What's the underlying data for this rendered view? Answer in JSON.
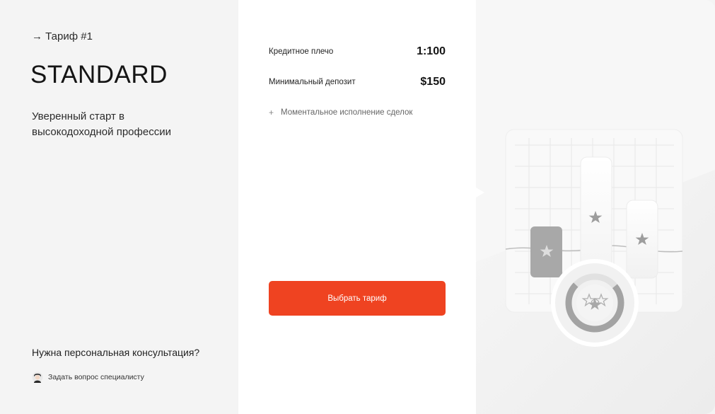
{
  "plan": {
    "tariff_number": "→ Тариф #1",
    "name": "STANDARD",
    "subtitle": "Уверенный старт в высокодоходной профессии",
    "consult_question": "Нужна персональная консультация?",
    "ask_specialist": "Задать вопрос специалисту"
  },
  "details": {
    "leverage_label": "Кредитное плечо",
    "leverage_value": "1:100",
    "deposit_label": "Минимальный депозит",
    "deposit_value": "$150",
    "feature_marker": "+",
    "feature": "Моментальное исполнение сделок",
    "cta_label": "Выбрать тариф"
  },
  "colors": {
    "accent": "#ef4321",
    "left_bg": "#f4f4f4",
    "middle_bg": "#ffffff"
  },
  "icons": {
    "avatar": "support-avatar-icon",
    "star": "star-icon"
  }
}
